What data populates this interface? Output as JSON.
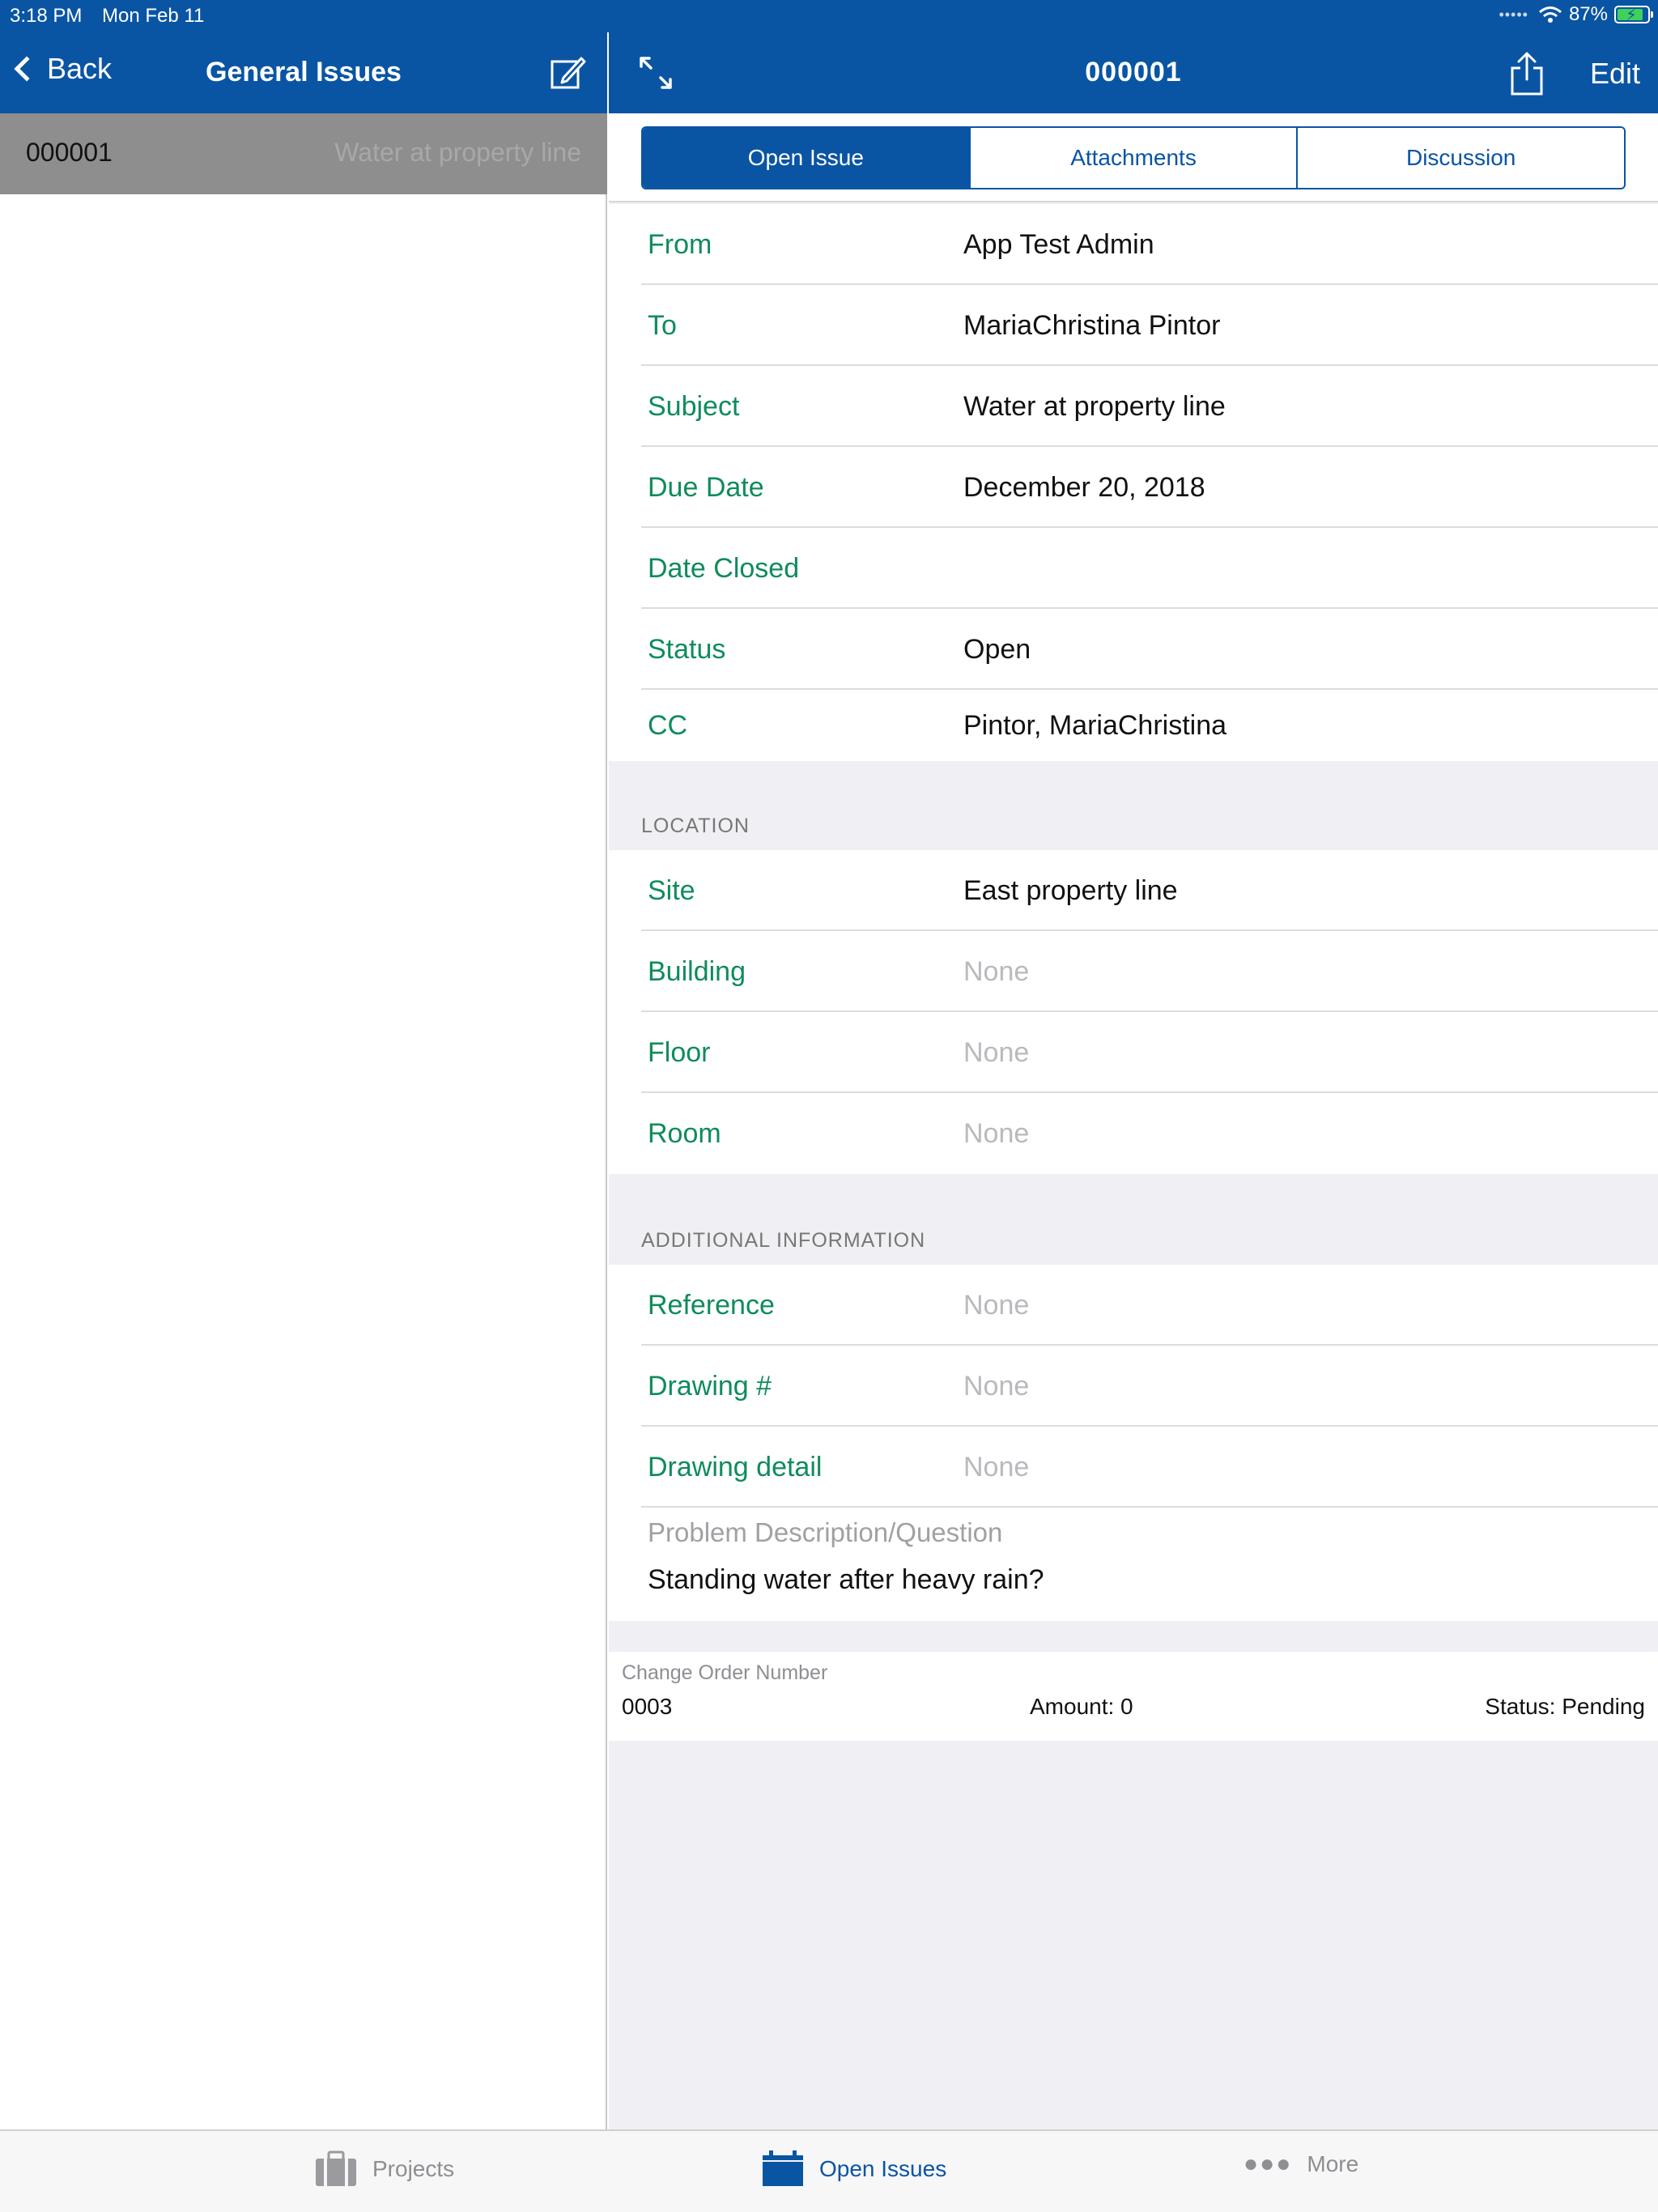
{
  "status_bar": {
    "time": "3:18 PM",
    "date": "Mon Feb 11",
    "battery": "87%",
    "battery_level": 0.87
  },
  "left_pane": {
    "nav": {
      "back_label": "Back",
      "title": "General Issues"
    },
    "list": [
      {
        "number": "000001",
        "subject": "Water at property line"
      }
    ]
  },
  "detail": {
    "nav": {
      "title": "000001",
      "edit_label": "Edit"
    },
    "tabs": {
      "open_issue": "Open Issue",
      "attachments": "Attachments",
      "discussion": "Discussion"
    },
    "fields": {
      "from": {
        "label": "From",
        "value": "App Test Admin"
      },
      "to": {
        "label": "To",
        "value": "MariaChristina Pintor"
      },
      "subject": {
        "label": "Subject",
        "value": "Water at property line"
      },
      "due_date": {
        "label": "Due Date",
        "value": "December 20, 2018"
      },
      "date_closed": {
        "label": "Date Closed",
        "value": ""
      },
      "status": {
        "label": "Status",
        "value": "Open"
      },
      "cc": {
        "label": "CC",
        "value": "Pintor, MariaChristina"
      }
    },
    "location": {
      "header": "LOCATION",
      "site": {
        "label": "Site",
        "value": "East property line"
      },
      "building": {
        "label": "Building",
        "value": "None"
      },
      "floor": {
        "label": "Floor",
        "value": "None"
      },
      "room": {
        "label": "Room",
        "value": "None"
      }
    },
    "additional": {
      "header": "ADDITIONAL INFORMATION",
      "reference": {
        "label": "Reference",
        "value": "None"
      },
      "drawing_num": {
        "label": "Drawing #",
        "value": "None"
      },
      "drawing_detail": {
        "label": "Drawing detail",
        "value": "None"
      },
      "problem": {
        "label": "Problem Description/Question",
        "value": "Standing water after heavy rain?"
      }
    },
    "change_order": {
      "label": "Change Order Number",
      "number": "0003",
      "amount": "Amount: 0",
      "status": "Status: Pending"
    }
  },
  "tab_bar": {
    "projects": "Projects",
    "open_issues": "Open Issues",
    "more": "More"
  },
  "colors": {
    "brand_blue": "#0a55a3",
    "label_green": "#0e8c5b",
    "placeholder_gray": "#b9b9be"
  }
}
